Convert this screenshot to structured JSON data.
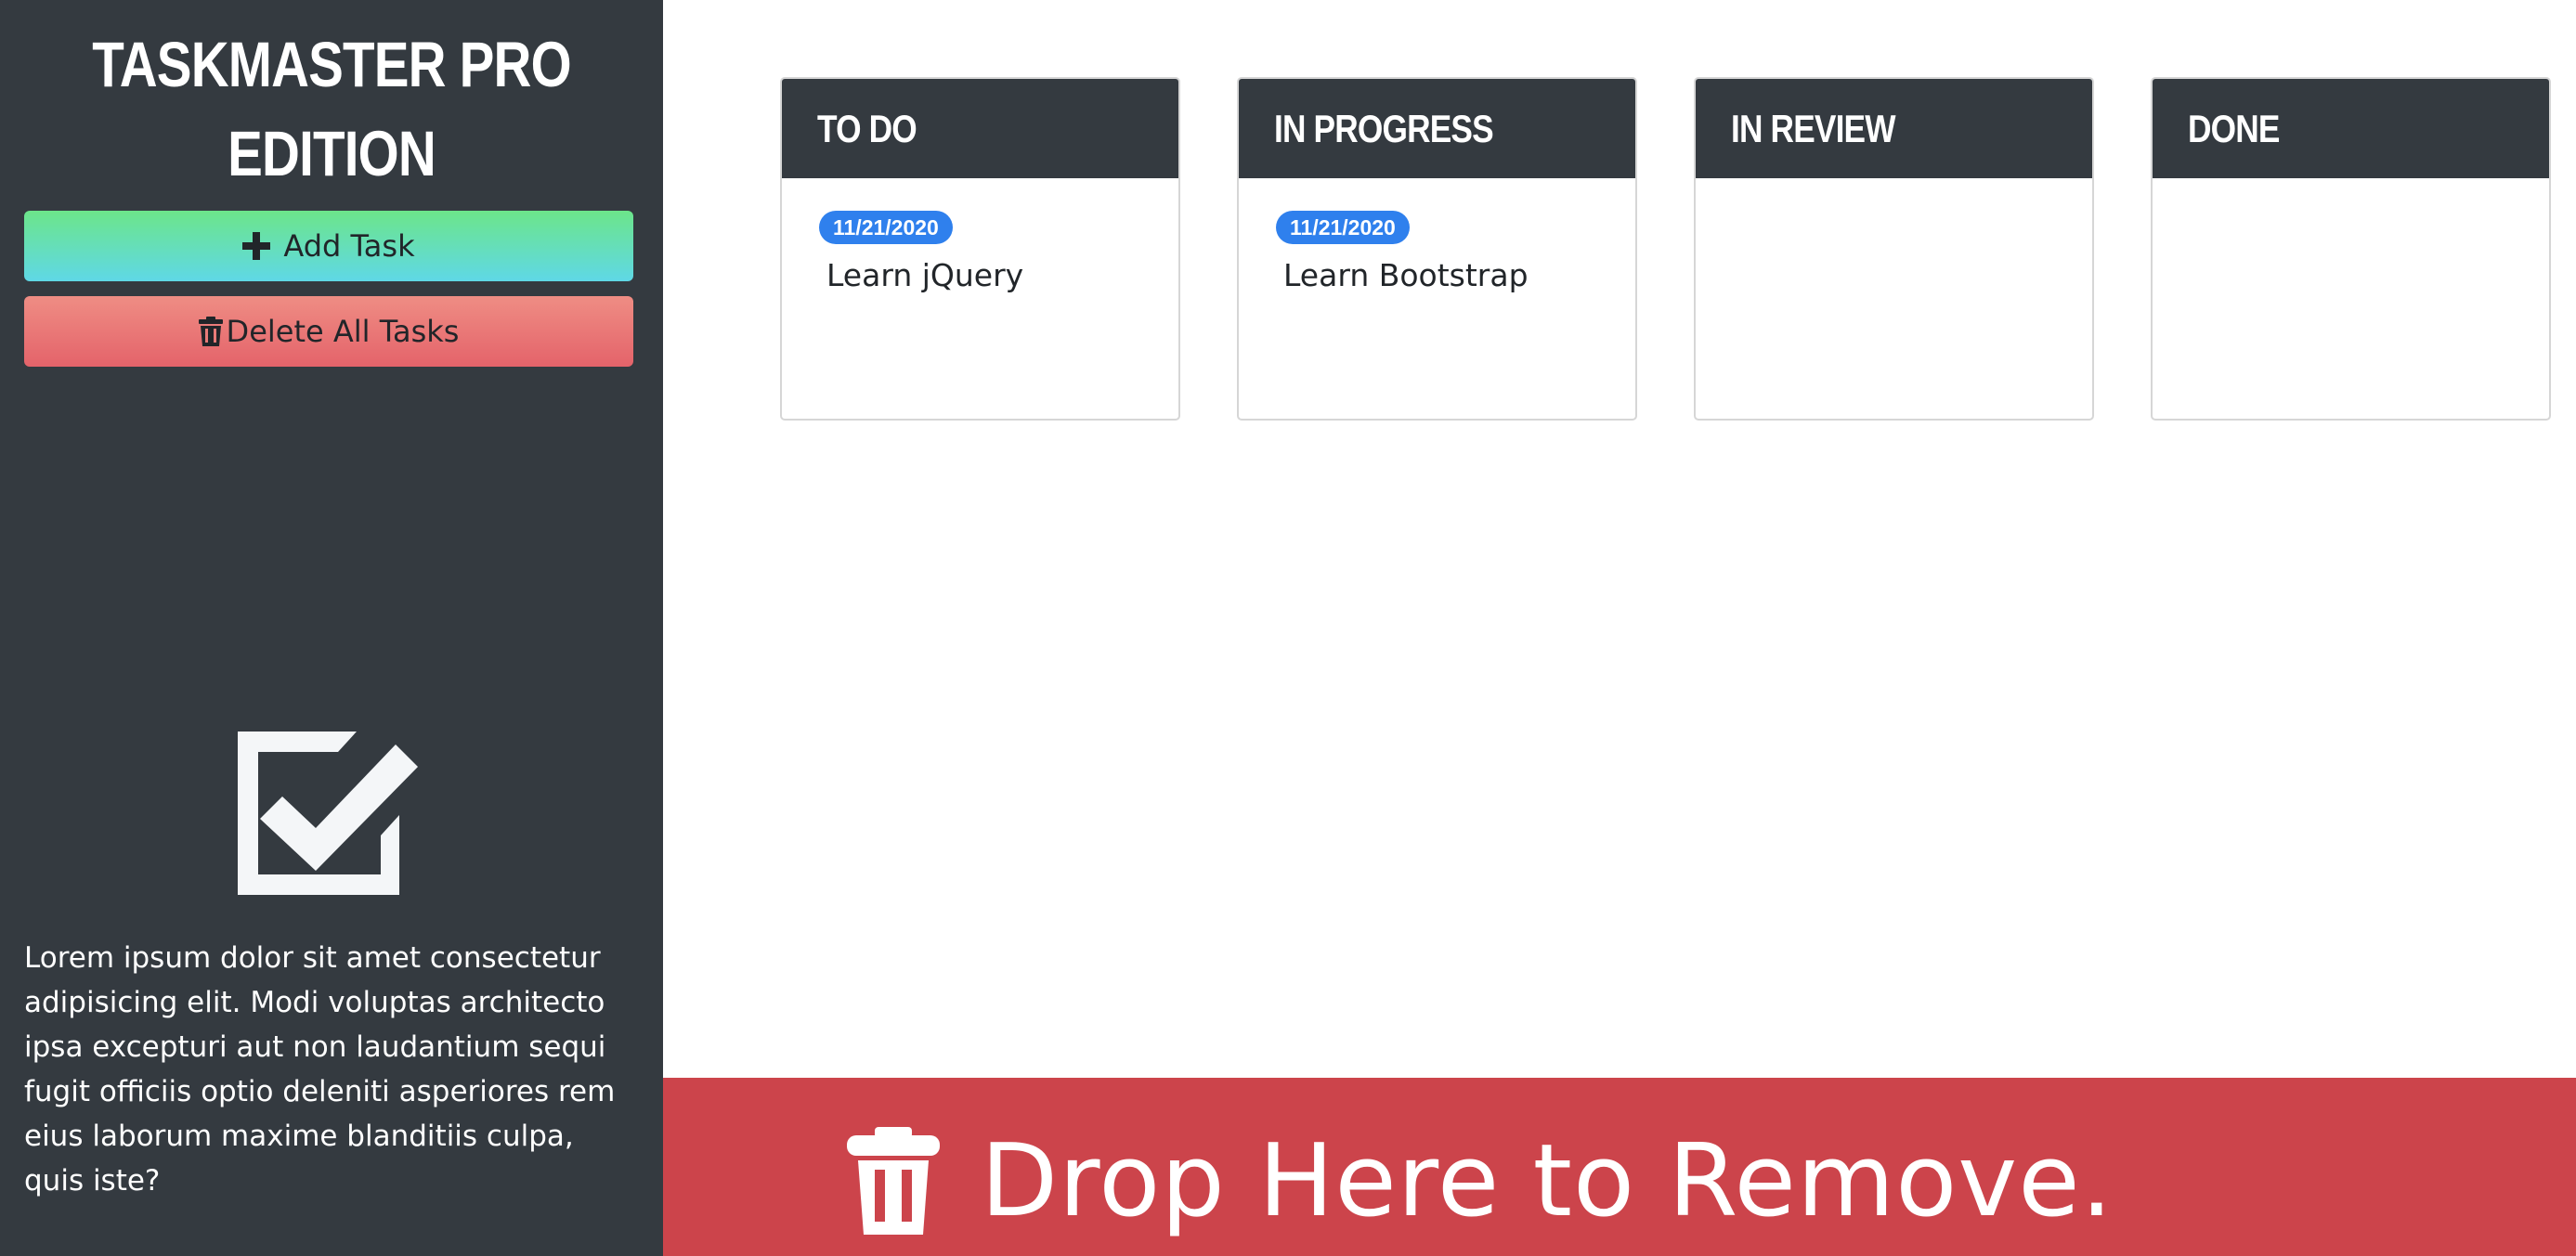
{
  "sidebar": {
    "title_line1": "Taskmaster Pro",
    "title_line2": "Edition",
    "add_button": {
      "label": "Add Task",
      "icon": "plus-icon"
    },
    "delete_button": {
      "label": "Delete All Tasks",
      "icon": "trash-icon"
    },
    "brand_icon": "checkbox-checked-icon",
    "description": "Lorem ipsum dolor sit amet consectetur adipisicing elit. Modi voluptas architecto ipsa excepturi aut non laudantium sequi fugit officiis optio deleniti asperiores rem eius laborum maxime blanditiis culpa, quis iste?"
  },
  "board": {
    "columns": [
      {
        "title": "To Do",
        "tasks": [
          {
            "date": "11/21/2020",
            "text": "Learn jQuery"
          }
        ]
      },
      {
        "title": "In Progress",
        "tasks": [
          {
            "date": "11/21/2020",
            "text": "Learn Bootstrap"
          }
        ]
      },
      {
        "title": "In Review",
        "tasks": []
      },
      {
        "title": "Done",
        "tasks": []
      }
    ]
  },
  "trash": {
    "label": "Drop Here to Remove.",
    "icon": "trash-icon"
  },
  "colors": {
    "sidebar_bg": "#343a40",
    "badge": "#2f80ed",
    "trash_zone": "#cc444b",
    "add_gradient_top": "#6ce58a",
    "add_gradient_bottom": "#5fd8e6",
    "delete_gradient_top": "#ef8d84",
    "delete_gradient_bottom": "#e4636a"
  }
}
